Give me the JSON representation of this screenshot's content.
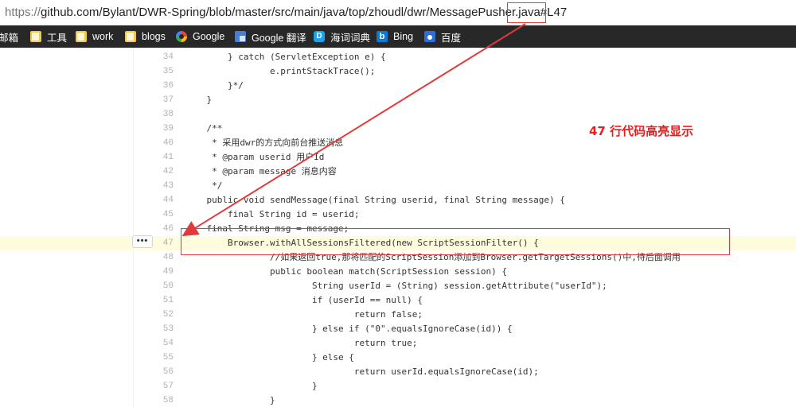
{
  "urlbar": {
    "prefix": "https://",
    "url": "github.com/Bylant/DWR-Spring/blob/master/src/main/java/top/zhoudl/dwr/MessagePusher.java#L47"
  },
  "bookmarks": [
    {
      "label": "邮箱",
      "icon": "none"
    },
    {
      "label": "工具",
      "icon": "folder-icon"
    },
    {
      "label": "work",
      "icon": "folder-icon"
    },
    {
      "label": "blogs",
      "icon": "folder-icon"
    },
    {
      "label": "Google",
      "icon": "google-icon"
    },
    {
      "label": "Google 翻译",
      "icon": "google-translate-icon"
    },
    {
      "label": "海词词典",
      "icon": "dict-icon"
    },
    {
      "label": "Bing",
      "icon": "bing-icon"
    },
    {
      "label": "百度",
      "icon": "baidu-icon"
    }
  ],
  "code_lines": [
    {
      "num": "34",
      "text": "        } catch (ServletException e) {"
    },
    {
      "num": "35",
      "text": "                e.printStackTrace();"
    },
    {
      "num": "36",
      "text": "        }*/"
    },
    {
      "num": "37",
      "text": "    }"
    },
    {
      "num": "38",
      "text": ""
    },
    {
      "num": "39",
      "text": "    /**"
    },
    {
      "num": "40",
      "text": "     * 采用dwr的方式向前台推送消息"
    },
    {
      "num": "41",
      "text": "     * @param userid 用户Id"
    },
    {
      "num": "42",
      "text": "     * @param message 消息内容"
    },
    {
      "num": "43",
      "text": "     */"
    },
    {
      "num": "44",
      "text": "    public void sendMessage(final String userid, final String message) {"
    },
    {
      "num": "45",
      "text": "        final String id = userid;"
    },
    {
      "num": "46",
      "text": "    final String msg = message;"
    },
    {
      "num": "47",
      "text": "        Browser.withAllSessionsFiltered(new ScriptSessionFilter() {"
    },
    {
      "num": "48",
      "text": "                //如果返回true,那将匹配的ScriptSession添加到Browser.getTargetSessions()中,待后面调用"
    },
    {
      "num": "49",
      "text": "                public boolean match(ScriptSession session) {"
    },
    {
      "num": "50",
      "text": "                        String userId = (String) session.getAttribute(\"userId\");"
    },
    {
      "num": "51",
      "text": "                        if (userId == null) {"
    },
    {
      "num": "52",
      "text": "                                return false;"
    },
    {
      "num": "53",
      "text": "                        } else if (\"0\".equalsIgnoreCase(id)) {"
    },
    {
      "num": "54",
      "text": "                                return true;"
    },
    {
      "num": "55",
      "text": "                        } else {"
    },
    {
      "num": "56",
      "text": "                                return userId.equalsIgnoreCase(id);"
    },
    {
      "num": "57",
      "text": "                        }"
    },
    {
      "num": "58",
      "text": "                }"
    }
  ],
  "highlighted_line": "47",
  "ellipsis_label": "•••",
  "annotation": {
    "text": "47  行代码高亮显示",
    "color": "#e81e1e"
  },
  "colors": {
    "bookmark_bar": "#282828",
    "highlight": "#fffbdd",
    "annotation": "#e03a3a"
  }
}
